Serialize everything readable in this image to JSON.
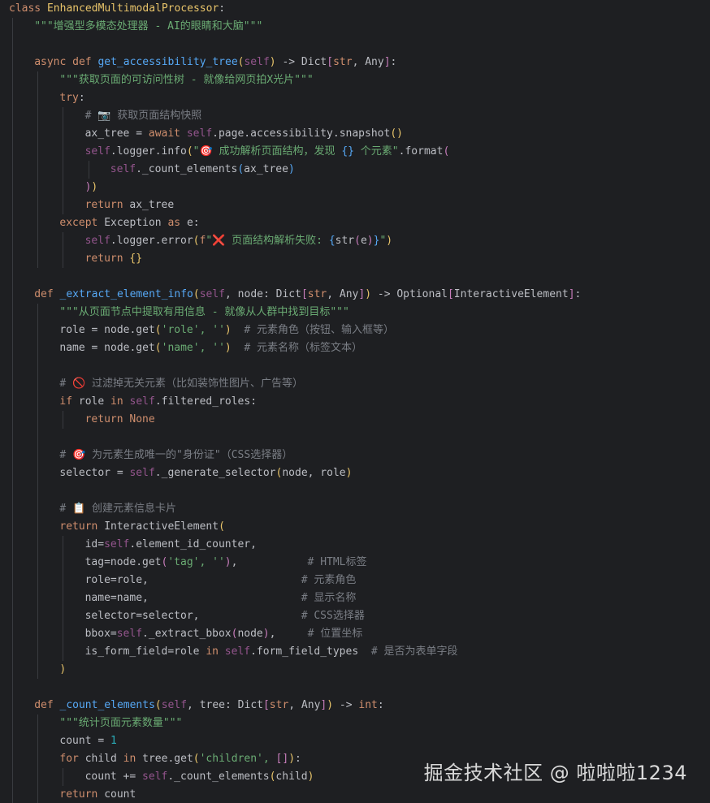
{
  "colors": {
    "background": "#1e1f22",
    "keyword": "#cf8e6d",
    "function": "#56a8f5",
    "class": "#e8c46a",
    "self": "#94558d",
    "string": "#6aab73",
    "comment": "#7a7e85",
    "number": "#2aacb8",
    "text": "#bcbec4"
  },
  "code_lines": [
    {
      "indent": 0,
      "tokens": [
        [
          "kw",
          "class "
        ],
        [
          "cls",
          "EnhancedMultimodalProcessor"
        ],
        [
          "plain",
          ":"
        ]
      ]
    },
    {
      "indent": 1,
      "tokens": [
        [
          "str",
          "\"\"\"增强型多模态处理器 - AI的眼睛和大脑\"\"\""
        ]
      ]
    },
    {
      "indent": 0,
      "tokens": []
    },
    {
      "indent": 1,
      "tokens": [
        [
          "kw",
          "async def "
        ],
        [
          "fn",
          "get_accessibility_tree"
        ],
        [
          "brk-y",
          "("
        ],
        [
          "self",
          "self"
        ],
        [
          "brk-y",
          ")"
        ],
        [
          "plain",
          " -> Dict"
        ],
        [
          "brk-p",
          "["
        ],
        [
          "kw",
          "str"
        ],
        [
          "plain",
          ", Any"
        ],
        [
          "brk-p",
          "]"
        ],
        [
          "plain",
          ":"
        ]
      ]
    },
    {
      "indent": 2,
      "tokens": [
        [
          "str",
          "\"\"\"获取页面的可访问性树 - 就像给网页拍X光片\"\"\""
        ]
      ]
    },
    {
      "indent": 2,
      "tokens": [
        [
          "kw",
          "try"
        ],
        [
          "plain",
          ":"
        ]
      ]
    },
    {
      "indent": 3,
      "tokens": [
        [
          "cmt",
          "# 📷 获取页面结构快照"
        ]
      ]
    },
    {
      "indent": 3,
      "tokens": [
        [
          "plain",
          "ax_tree = "
        ],
        [
          "kw",
          "await "
        ],
        [
          "self",
          "self"
        ],
        [
          "plain",
          ".page.accessibility.snapshot"
        ],
        [
          "brk-y",
          "()"
        ]
      ]
    },
    {
      "indent": 3,
      "tokens": [
        [
          "self",
          "self"
        ],
        [
          "plain",
          ".logger.info"
        ],
        [
          "brk-y",
          "("
        ],
        [
          "str",
          "\"🎯 成功解析页面结构，发现 "
        ],
        [
          "brk-b",
          "{}"
        ],
        [
          "str",
          " 个元素\""
        ],
        [
          "plain",
          ".format"
        ],
        [
          "brk-p",
          "("
        ]
      ]
    },
    {
      "indent": 4,
      "tokens": [
        [
          "self",
          "self"
        ],
        [
          "plain",
          "._count_elements"
        ],
        [
          "brk-b",
          "("
        ],
        [
          "plain",
          "ax_tree"
        ],
        [
          "brk-b",
          ")"
        ]
      ]
    },
    {
      "indent": 3,
      "tokens": [
        [
          "brk-p",
          ")"
        ],
        [
          "brk-y",
          ")"
        ]
      ]
    },
    {
      "indent": 3,
      "tokens": [
        [
          "kw",
          "return "
        ],
        [
          "plain",
          "ax_tree"
        ]
      ]
    },
    {
      "indent": 2,
      "tokens": [
        [
          "kw",
          "except "
        ],
        [
          "plain",
          "Exception "
        ],
        [
          "kw",
          "as "
        ],
        [
          "plain",
          "e:"
        ]
      ]
    },
    {
      "indent": 3,
      "tokens": [
        [
          "self",
          "self"
        ],
        [
          "plain",
          ".logger.error"
        ],
        [
          "brk-y",
          "("
        ],
        [
          "kw",
          "f"
        ],
        [
          "str",
          "\"❌ 页面结构解析失败: "
        ],
        [
          "brk-b",
          "{"
        ],
        [
          "plain",
          "str"
        ],
        [
          "brk-p",
          "("
        ],
        [
          "plain",
          "e"
        ],
        [
          "brk-p",
          ")"
        ],
        [
          "brk-b",
          "}"
        ],
        [
          "str",
          "\""
        ],
        [
          "brk-y",
          ")"
        ]
      ]
    },
    {
      "indent": 3,
      "tokens": [
        [
          "kw",
          "return "
        ],
        [
          "brk-y",
          "{}"
        ]
      ]
    },
    {
      "indent": 0,
      "tokens": []
    },
    {
      "indent": 1,
      "tokens": [
        [
          "kw",
          "def "
        ],
        [
          "fn",
          "_extract_element_info"
        ],
        [
          "brk-y",
          "("
        ],
        [
          "self",
          "self"
        ],
        [
          "plain",
          ", node: Dict"
        ],
        [
          "brk-p",
          "["
        ],
        [
          "kw",
          "str"
        ],
        [
          "plain",
          ", Any"
        ],
        [
          "brk-p",
          "]"
        ],
        [
          "brk-y",
          ")"
        ],
        [
          "plain",
          " -> Optional"
        ],
        [
          "brk-p",
          "["
        ],
        [
          "plain",
          "InteractiveElement"
        ],
        [
          "brk-p",
          "]"
        ],
        [
          "plain",
          ":"
        ]
      ]
    },
    {
      "indent": 2,
      "tokens": [
        [
          "str",
          "\"\"\"从页面节点中提取有用信息 - 就像从人群中找到目标\"\"\""
        ]
      ]
    },
    {
      "indent": 2,
      "tokens": [
        [
          "plain",
          "role = node.get"
        ],
        [
          "brk-y",
          "("
        ],
        [
          "str",
          "'role', ''"
        ],
        [
          "brk-y",
          ")"
        ],
        [
          "cmt",
          "  # 元素角色（按钮、输入框等）"
        ]
      ]
    },
    {
      "indent": 2,
      "tokens": [
        [
          "plain",
          "name = node.get"
        ],
        [
          "brk-y",
          "("
        ],
        [
          "str",
          "'name', ''"
        ],
        [
          "brk-y",
          ")"
        ],
        [
          "cmt",
          "  # 元素名称（标签文本）"
        ]
      ]
    },
    {
      "indent": 0,
      "tokens": []
    },
    {
      "indent": 2,
      "tokens": [
        [
          "cmt",
          "# 🚫 过滤掉无关元素（比如装饰性图片、广告等）"
        ]
      ]
    },
    {
      "indent": 2,
      "tokens": [
        [
          "kw",
          "if "
        ],
        [
          "plain",
          "role "
        ],
        [
          "kw",
          "in "
        ],
        [
          "self",
          "self"
        ],
        [
          "plain",
          ".filtered_roles:"
        ]
      ]
    },
    {
      "indent": 3,
      "tokens": [
        [
          "kw",
          "return "
        ],
        [
          "kw",
          "None"
        ]
      ]
    },
    {
      "indent": 0,
      "tokens": []
    },
    {
      "indent": 2,
      "tokens": [
        [
          "cmt",
          "# 🎯 为元素生成唯一的\"身份证\"（CSS选择器）"
        ]
      ]
    },
    {
      "indent": 2,
      "tokens": [
        [
          "plain",
          "selector = "
        ],
        [
          "self",
          "self"
        ],
        [
          "plain",
          "._generate_selector"
        ],
        [
          "brk-y",
          "("
        ],
        [
          "plain",
          "node, role"
        ],
        [
          "brk-y",
          ")"
        ]
      ]
    },
    {
      "indent": 0,
      "tokens": []
    },
    {
      "indent": 2,
      "tokens": [
        [
          "cmt",
          "# 📋 创建元素信息卡片"
        ]
      ]
    },
    {
      "indent": 2,
      "tokens": [
        [
          "kw",
          "return "
        ],
        [
          "plain",
          "InteractiveElement"
        ],
        [
          "brk-y",
          "("
        ]
      ]
    },
    {
      "indent": 3,
      "tokens": [
        [
          "plain",
          "id="
        ],
        [
          "self",
          "self"
        ],
        [
          "plain",
          ".element_id_counter,"
        ]
      ]
    },
    {
      "indent": 3,
      "tokens": [
        [
          "plain",
          "tag=node.get"
        ],
        [
          "brk-p",
          "("
        ],
        [
          "str",
          "'tag', ''"
        ],
        [
          "brk-p",
          ")"
        ],
        [
          "plain",
          ",           "
        ],
        [
          "cmt",
          "# HTML标签"
        ]
      ]
    },
    {
      "indent": 3,
      "tokens": [
        [
          "plain",
          "role=role,                        "
        ],
        [
          "cmt",
          "# 元素角色"
        ]
      ]
    },
    {
      "indent": 3,
      "tokens": [
        [
          "plain",
          "name=name,                        "
        ],
        [
          "cmt",
          "# 显示名称"
        ]
      ]
    },
    {
      "indent": 3,
      "tokens": [
        [
          "plain",
          "selector=selector,                "
        ],
        [
          "cmt",
          "# CSS选择器"
        ]
      ]
    },
    {
      "indent": 3,
      "tokens": [
        [
          "plain",
          "bbox="
        ],
        [
          "self",
          "self"
        ],
        [
          "plain",
          "._extract_bbox"
        ],
        [
          "brk-p",
          "("
        ],
        [
          "plain",
          "node"
        ],
        [
          "brk-p",
          ")"
        ],
        [
          "plain",
          ",     "
        ],
        [
          "cmt",
          "# 位置坐标"
        ]
      ]
    },
    {
      "indent": 3,
      "tokens": [
        [
          "plain",
          "is_form_field=role "
        ],
        [
          "kw",
          "in "
        ],
        [
          "self",
          "self"
        ],
        [
          "plain",
          ".form_field_types  "
        ],
        [
          "cmt",
          "# 是否为表单字段"
        ]
      ]
    },
    {
      "indent": 2,
      "tokens": [
        [
          "brk-y",
          ")"
        ]
      ]
    },
    {
      "indent": 0,
      "tokens": []
    },
    {
      "indent": 1,
      "tokens": [
        [
          "kw",
          "def "
        ],
        [
          "fn",
          "_count_elements"
        ],
        [
          "brk-y",
          "("
        ],
        [
          "self",
          "self"
        ],
        [
          "plain",
          ", tree: Dict"
        ],
        [
          "brk-p",
          "["
        ],
        [
          "kw",
          "str"
        ],
        [
          "plain",
          ", Any"
        ],
        [
          "brk-p",
          "]"
        ],
        [
          "brk-y",
          ")"
        ],
        [
          "plain",
          " -> "
        ],
        [
          "kw",
          "int"
        ],
        [
          "plain",
          ":"
        ]
      ]
    },
    {
      "indent": 2,
      "tokens": [
        [
          "str",
          "\"\"\"统计页面元素数量\"\"\""
        ]
      ]
    },
    {
      "indent": 2,
      "tokens": [
        [
          "plain",
          "count = "
        ],
        [
          "num",
          "1"
        ]
      ]
    },
    {
      "indent": 2,
      "tokens": [
        [
          "kw",
          "for "
        ],
        [
          "plain",
          "child "
        ],
        [
          "kw",
          "in "
        ],
        [
          "plain",
          "tree.get"
        ],
        [
          "brk-y",
          "("
        ],
        [
          "str",
          "'children', "
        ],
        [
          "brk-p",
          "[]"
        ],
        [
          "brk-y",
          ")"
        ],
        [
          "plain",
          ":"
        ]
      ]
    },
    {
      "indent": 3,
      "tokens": [
        [
          "plain",
          "count += "
        ],
        [
          "self",
          "self"
        ],
        [
          "plain",
          "._count_elements"
        ],
        [
          "brk-y",
          "("
        ],
        [
          "plain",
          "child"
        ],
        [
          "brk-y",
          ")"
        ]
      ]
    },
    {
      "indent": 2,
      "tokens": [
        [
          "kw",
          "return "
        ],
        [
          "plain",
          "count"
        ]
      ]
    }
  ],
  "watermark": {
    "text": "掘金技术社区 @ 啦啦啦1234"
  }
}
